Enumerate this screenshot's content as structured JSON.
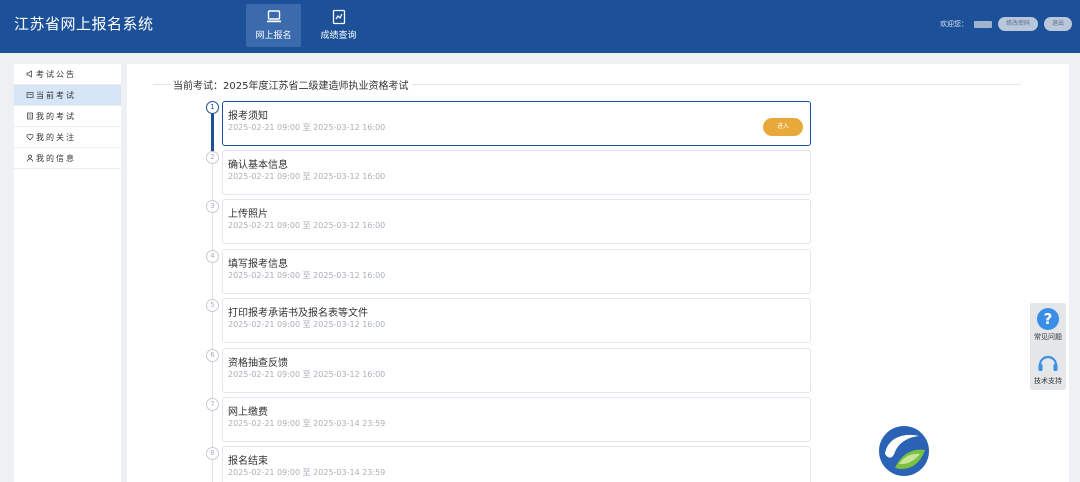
{
  "header": {
    "title": "江苏省网上报名系统",
    "nav": [
      {
        "label": "网上报名",
        "icon": "laptop-icon"
      },
      {
        "label": "成绩查询",
        "icon": "score-doc-icon"
      }
    ],
    "user_label": "欢迎您：",
    "buttons": [
      "修改密码",
      "退出"
    ]
  },
  "sidebar": {
    "items": [
      {
        "label": "考试公告",
        "icon": "megaphone-icon"
      },
      {
        "label": "当前考试",
        "icon": "current-exam-icon"
      },
      {
        "label": "我的考试",
        "icon": "my-exam-icon"
      },
      {
        "label": "我的关注",
        "icon": "heart-icon"
      },
      {
        "label": "我的信息",
        "icon": "user-icon"
      }
    ]
  },
  "main": {
    "current_exam_prefix": "当前考试：",
    "current_exam_name": "2025年度江苏省二级建造师执业资格考试",
    "steps": [
      {
        "num": "1",
        "title": "报考须知",
        "date": "2025-02-21 09:00 至 2025-03-12 16:00",
        "button": "进入"
      },
      {
        "num": "2",
        "title": "确认基本信息",
        "date": "2025-02-21 09:00 至 2025-03-12 16:00"
      },
      {
        "num": "3",
        "title": "上传照片",
        "date": "2025-02-21 09:00 至 2025-03-12 16:00"
      },
      {
        "num": "4",
        "title": "填写报考信息",
        "date": "2025-02-21 09:00 至 2025-03-12 16:00"
      },
      {
        "num": "5",
        "title": "打印报考承诺书及报名表等文件",
        "date": "2025-02-21 09:00 至 2025-03-12 16:00"
      },
      {
        "num": "6",
        "title": "资格抽查反馈",
        "date": "2025-02-21 09:00 至 2025-03-12 16:00"
      },
      {
        "num": "7",
        "title": "网上缴费",
        "date": "2025-02-21 09:00 至 2025-03-14 23:59"
      },
      {
        "num": "8",
        "title": "报名结束",
        "date": "2025-02-21 09:00 至 2025-03-14 23:59"
      }
    ]
  },
  "float": {
    "items": [
      {
        "label": "常见问题",
        "icon": "question-icon"
      },
      {
        "label": "技术支持",
        "icon": "headset-icon"
      }
    ]
  },
  "colors": {
    "brand": "#1c5199",
    "accent": "#e8a93a",
    "sidebar_active": "#d6e6f7"
  }
}
